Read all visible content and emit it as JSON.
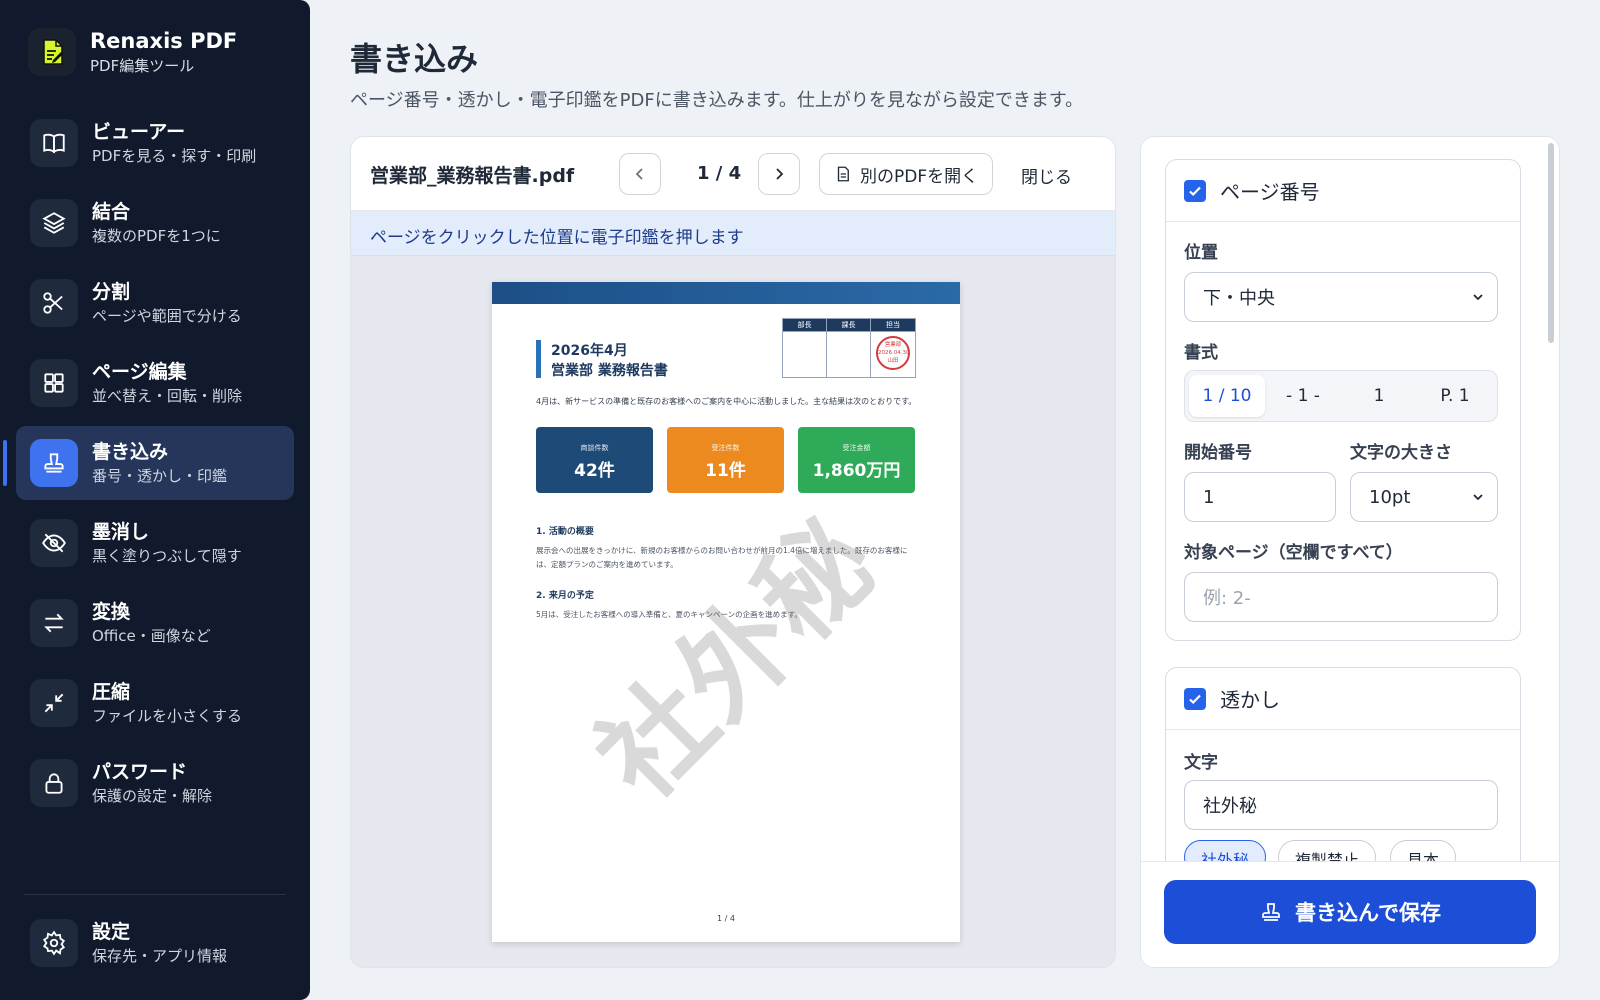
{
  "app": {
    "title": "Renaxis PDF",
    "subtitle": "PDF編集ツール"
  },
  "sidebar": {
    "items": [
      {
        "label": "ビューアー",
        "desc": "PDFを見る・探す・印刷",
        "icon": "book-icon"
      },
      {
        "label": "結合",
        "desc": "複数のPDFを1つに",
        "icon": "layers-icon"
      },
      {
        "label": "分割",
        "desc": "ページや範囲で分ける",
        "icon": "scissors-icon"
      },
      {
        "label": "ページ編集",
        "desc": "並べ替え・回転・削除",
        "icon": "grid-icon"
      },
      {
        "label": "書き込み",
        "desc": "番号・透かし・印鑑",
        "icon": "stamp-icon",
        "active": true
      },
      {
        "label": "墨消し",
        "desc": "黒く塗りつぶして隠す",
        "icon": "eye-off-icon"
      },
      {
        "label": "変換",
        "desc": "Office・画像など",
        "icon": "swap-icon"
      },
      {
        "label": "圧縮",
        "desc": "ファイルを小さくする",
        "icon": "compress-icon"
      },
      {
        "label": "パスワード",
        "desc": "保護の設定・解除",
        "icon": "lock-icon"
      }
    ],
    "settings": {
      "label": "設定",
      "desc": "保存先・アプリ情報",
      "icon": "gear-icon"
    }
  },
  "main": {
    "title": "書き込み",
    "description": "ページ番号・透かし・電子印鑑をPDFに書き込みます。仕上がりを見ながら設定できます。"
  },
  "viewer": {
    "file_name": "営業部_業務報告書.pdf",
    "page_indicator": "1 / 4",
    "open_other": "別のPDFを開く",
    "close": "閉じる",
    "info": "ページをクリックした位置に電子印鑑を押します"
  },
  "pdf": {
    "title_line1": "2026年4月",
    "title_line2": "営業部 業務報告書",
    "approval_headers": [
      "部長",
      "課長",
      "担当"
    ],
    "seal_lines": [
      "営業部",
      "2026.04.30",
      "山田"
    ],
    "intro": "4月は、新サービスの準備と既存のお客様へのご案内を中心に活動しました。主な結果は次のとおりです。",
    "kpis": [
      {
        "label": "商談件数",
        "value": "42件",
        "color": "#1e4a78"
      },
      {
        "label": "受注件数",
        "value": "11件",
        "color": "#ec8a1f"
      },
      {
        "label": "受注金額",
        "value": "1,860万円",
        "color": "#2eaa58"
      }
    ],
    "section1_heading": "1. 活動の概要",
    "section1_body": "展示会への出展をきっかけに、新規のお客様からのお問い合わせが前月の1.4倍に増えました。既存のお客様には、定額プランのご案内を進めています。",
    "section2_heading": "2. 来月の予定",
    "section2_body": "5月は、受注したお客様への導入準備と、夏のキャンペーンの企画を進めます。",
    "footer": "1 / 4",
    "watermark": "社外秘"
  },
  "panel": {
    "page_number": {
      "enabled": true,
      "title": "ページ番号",
      "position_label": "位置",
      "position_value": "下・中央",
      "format_label": "書式",
      "formats": [
        "1 / 10",
        "- 1 -",
        "1",
        "P. 1"
      ],
      "selected_format": "1 / 10",
      "start_label": "開始番号",
      "start_value": "1",
      "size_label": "文字の大きさ",
      "size_value": "10pt",
      "pages_label": "対象ページ（空欄ですべて）",
      "pages_placeholder": "例: 2-"
    },
    "watermark": {
      "enabled": true,
      "title": "透かし",
      "text_label": "文字",
      "text_value": "社外秘",
      "presets": [
        "社外秘",
        "複製禁止",
        "見本"
      ]
    },
    "save_button": "書き込んで保存"
  },
  "colors": {
    "accent": "#1d4ed8",
    "sidebar_bg": "#111a2c",
    "active_item": "#25365a"
  }
}
